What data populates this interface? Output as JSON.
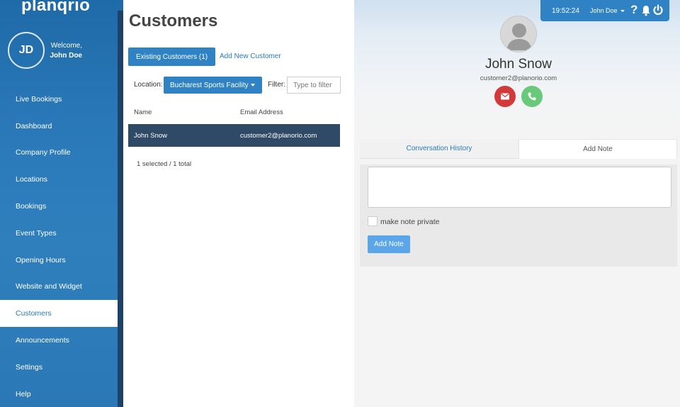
{
  "sidebar": {
    "logo": "planqrio",
    "avatar_initials": "JD",
    "welcome": "Welcome,",
    "user_name": "John Doe",
    "items": [
      {
        "label": "Live Bookings"
      },
      {
        "label": "Dashboard"
      },
      {
        "label": "Company Profile"
      },
      {
        "label": "Locations"
      },
      {
        "label": "Bookings"
      },
      {
        "label": "Event Types"
      },
      {
        "label": "Opening Hours"
      },
      {
        "label": "Website and Widget"
      },
      {
        "label": "Customers",
        "active": true
      },
      {
        "label": "Announcements"
      },
      {
        "label": "Settings"
      },
      {
        "label": "Help"
      }
    ]
  },
  "customers": {
    "title": "Customers",
    "tab_existing": "Existing Customers (1)",
    "tab_add": "Add New Customer",
    "location_label": "Location:",
    "location_value": "Bucharest Sports Facility",
    "filter_label": "Filter:",
    "filter_placeholder": "Type to filter",
    "columns": {
      "name": "Name",
      "email": "Email Address"
    },
    "rows": [
      {
        "name": "John Snow",
        "email": "customer2@planorio.com",
        "selected": true
      }
    ],
    "selection_status": "1 selected / 1 total"
  },
  "topbar": {
    "time": "19:52:24",
    "user": "John Doe"
  },
  "detail": {
    "name": "John Snow",
    "email": "customer2@planorio.com",
    "tab_history": "Conversation History",
    "tab_note": "Add Note",
    "note_value": "",
    "private_label": "make note private",
    "private_checked": false,
    "add_button": "Add Note"
  },
  "colors": {
    "primary": "#2f82c4",
    "sidebar": "#2a78b8",
    "selected_row": "#2f4a66",
    "mail_button": "#d23a3a",
    "phone_button": "#69c97a",
    "add_note_button": "#5ba6ea"
  },
  "icons": [
    "question-icon",
    "bell-icon",
    "power-icon",
    "envelope-icon",
    "phone-icon",
    "user-placeholder-icon"
  ]
}
